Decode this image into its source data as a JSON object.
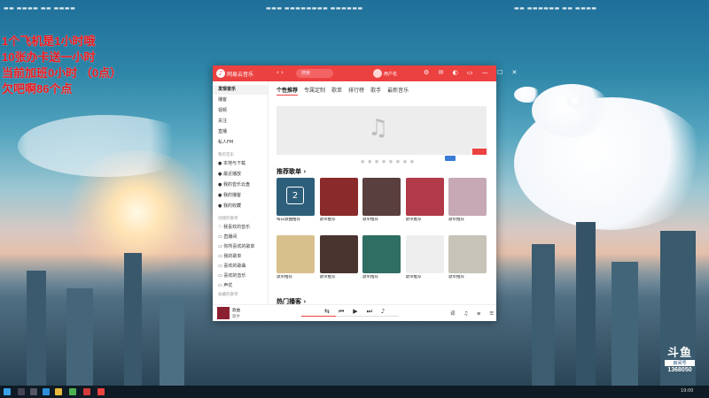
{
  "overlay_text": [
    "1个飞机是1小时哦",
    "10张办卡送一小时",
    "当前加班0小时 （0点）",
    "欠吧啊86个点"
  ],
  "top_ticker": [
    "▬▬ ▬▬▬▬ ▬▬ ▬▬▬▬",
    "▬▬▬ ▬▬▬▬▬▬▬▬ ▬▬▬▬▬▬",
    "▬▬ ▬▬▬▬▬▬ ▬▬ ▬▬▬▬"
  ],
  "app": {
    "title": "网易云音乐",
    "search_placeholder": "搜索",
    "username": "用户名",
    "nav_arrows": "‹ ›",
    "title_icons": "⚙ ✉ ◐ ▭ — ☐ ✕",
    "sidebar": {
      "items": [
        {
          "label": "发现音乐",
          "active": true
        },
        {
          "label": "播客"
        },
        {
          "label": "视频"
        },
        {
          "label": "关注"
        },
        {
          "label": "直播"
        },
        {
          "label": "私人FM"
        }
      ],
      "mine_header": "我的音乐",
      "mine": [
        "● 本地与下载",
        "● 最近播放",
        "● 我的音乐云盘",
        "● 我的播客",
        "● 我的收藏"
      ],
      "created_header": "创建的歌单",
      "created": [
        "♡ 我喜欢的音乐",
        "▭ 直播间",
        "▭ 你所喜欢的歌单",
        "▭ 我的歌单",
        "▭ 喜欢的歌曲",
        "▭ 喜欢的音乐",
        "▭ 声优"
      ],
      "collected_header": "收藏的歌单",
      "collected": [
        "▭ 歌单"
      ]
    },
    "tabs": [
      "个性推荐",
      "专属定制",
      "歌单",
      "排行榜",
      "歌手",
      "最新音乐"
    ],
    "active_tab": 0,
    "banner_dots": "● ● ● ● ● ● ● ●",
    "section_title": "推荐歌单 ›",
    "section_title2": "热门播客 ›",
    "cards": [
      {
        "caption": "每日歌曲推荐",
        "color": "#2d5f7a"
      },
      {
        "caption": "歌单推荐",
        "color": "#8a2a2a"
      },
      {
        "caption": "歌单推荐",
        "color": "#5a3f3f"
      },
      {
        "caption": "歌单推荐",
        "color": "#b23a48"
      },
      {
        "caption": "歌单推荐",
        "color": "#c6a9b5"
      },
      {
        "caption": "歌单推荐",
        "color": "#d8c08c"
      },
      {
        "caption": "歌单推荐",
        "color": "#4a3430"
      },
      {
        "caption": "歌单推荐",
        "color": "#2f6e63"
      },
      {
        "caption": "歌单推荐",
        "color": "#eeeeee"
      },
      {
        "caption": "歌单推荐",
        "color": "#c7c3b8"
      }
    ],
    "daily_date": "2",
    "player": {
      "title": "歌曲",
      "artist": "歌手",
      "controls": [
        "⇆",
        "⏮",
        "▶",
        "⏭",
        "♪"
      ],
      "progress": 0.35,
      "right_icons": "词 ♫ ≡ ☰"
    }
  },
  "douyu": {
    "logo": "斗鱼",
    "sub": "房间号",
    "room": "1368050"
  },
  "tray_time": "19:00"
}
